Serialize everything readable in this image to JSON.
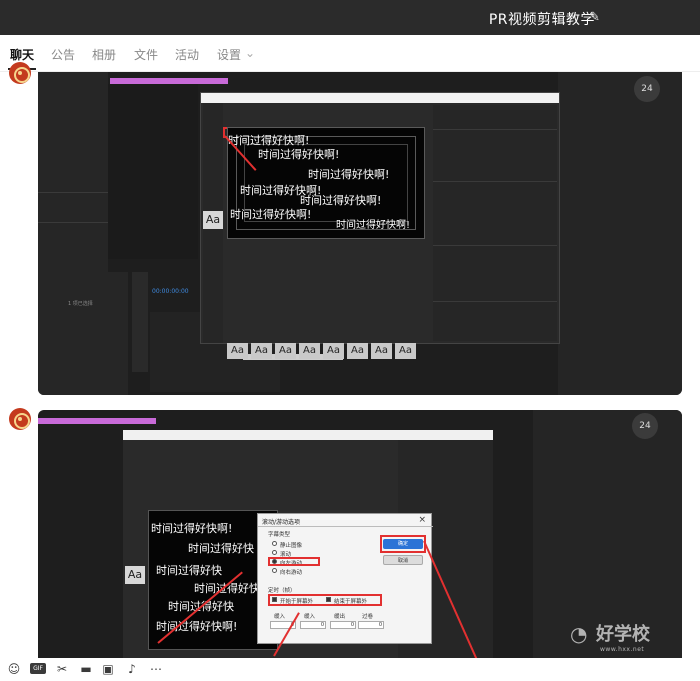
{
  "header": {
    "title": "PR视频剪辑教学",
    "edit_icon": "pencil-icon"
  },
  "tabs": [
    {
      "label": "聊天",
      "active": true
    },
    {
      "label": "公告"
    },
    {
      "label": "相册"
    },
    {
      "label": "文件"
    },
    {
      "label": "活动"
    },
    {
      "label": "设置"
    }
  ],
  "messages": [
    {
      "avatar": "emblem-avatar",
      "screenshot": {
        "captions": [
          "时间过得好快啊!",
          "时间过得好快啊!",
          "时间过得好快啊!",
          "时间过得好快啊!",
          "时间过得好快啊!",
          "时间过得好快啊!"
        ],
        "badge": "24",
        "timecode": "00:00:00:00",
        "aa_label": "Aa"
      }
    },
    {
      "avatar": "emblem-avatar",
      "screenshot": {
        "captions": [
          "时间过得好快啊!",
          "时间过得好快",
          "时间过得好快",
          "时间过得好快",
          "时间过得好快",
          "时间过得好快啊!"
        ],
        "badge": "24",
        "aa_label": "Aa",
        "dialog": {
          "title": "滚动/游动选项",
          "section_type": "字幕类型",
          "radio_options": [
            "静止图像",
            "滚动",
            "向左游动",
            "向右游动"
          ],
          "selected_option_index": 2,
          "section_timing": "定时（帧）",
          "check_start": "开始于屏幕外",
          "check_end": "结束于屏幕外",
          "fields": [
            {
              "label": "缓入",
              "value": "0"
            },
            {
              "label": "缓入",
              "value": "0"
            },
            {
              "label": "缓出",
              "value": "0"
            },
            {
              "label": "过卷",
              "value": "0"
            }
          ],
          "ok_label": "确定",
          "cancel_label": "取消"
        }
      }
    }
  ],
  "watermark": {
    "brand": "好学校",
    "sub": "www.hxx.net"
  },
  "toolbar_icons": [
    "emoji-icon",
    "gif-icon",
    "scissors-icon",
    "folder-icon",
    "image-icon",
    "bell-icon",
    "more-icon"
  ],
  "colors": {
    "titlebar_bg": "#2b2b2b",
    "highlight_red": "#e23030",
    "primary_blue": "#2b73d6",
    "timeline_pink": "#c86ad8"
  }
}
